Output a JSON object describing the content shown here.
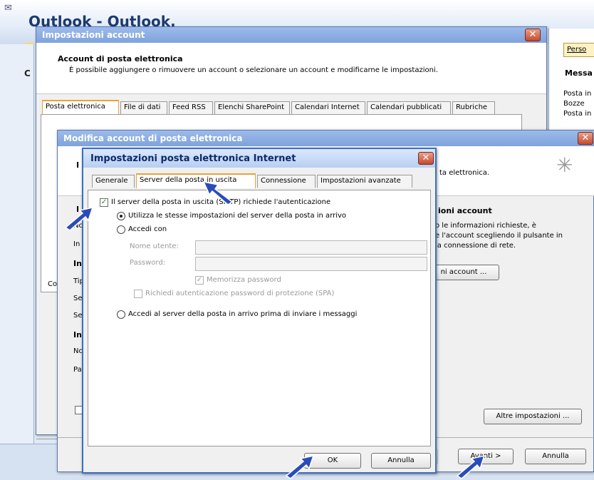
{
  "outlook": {
    "title": "Outlook - Outlook.",
    "left_letter": "C",
    "right_panel": {
      "button": "Perso",
      "header": "Messa",
      "items": [
        "Posta in",
        "Bozze",
        "Posta in"
      ]
    }
  },
  "account_window": {
    "title": "Impostazioni account",
    "heading": "Account di posta elettronica",
    "subtitle": "È possibile aggiungere o rimuovere un account o selezionare un account e modificarne le impostazioni.",
    "tabs": [
      "Posta elettronica",
      "File di dati",
      "Feed RSS",
      "Elenchi SharePoint",
      "Calendari Internet",
      "Calendari pubblicati",
      "Rubriche"
    ],
    "active_tab": "Posta elettronica"
  },
  "modify_window": {
    "title": "Modifica account di posta elettronica",
    "email_text": "ta elettronica.",
    "section_heading": "ioni account",
    "info_lines": [
      "o le informazioni richieste, è",
      "e l'account scegliendo il pulsante in",
      "la connessione di rete."
    ],
    "test_button": "ni account ...",
    "more_settings_button": "Altre impostazioni ...",
    "back_fragment": "<",
    "next_button": "Avanti >",
    "cancel_button": "Annulla",
    "left_letters": [
      "I",
      "I",
      "Nc",
      "In",
      "In",
      "Tip",
      "Se",
      "Se",
      "In",
      "Nc",
      "Pa",
      "Co"
    ]
  },
  "internet_dialog": {
    "title": "Impostazioni posta elettronica Internet",
    "tabs": [
      "Generale",
      "Server della posta in uscita",
      "Connessione",
      "Impostazioni avanzate"
    ],
    "active_tab": "Server della posta in uscita",
    "smtp_auth_label": "Il server della posta in uscita (SMTP) richiede l'autenticazione",
    "smtp_auth_checked": true,
    "use_same_label": "Utilizza le stesse impostazioni del server della posta in arrivo",
    "login_with_label": "Accedi con",
    "username_label": "Nome utente:",
    "password_label": "Password:",
    "remember_password_label": "Memorizza password",
    "spa_label": "Richiedi autenticazione password di protezione (SPA)",
    "login_incoming_first_label": "Accedi al server della posta in arrivo prima di inviare i messaggi",
    "ok_button": "OK",
    "cancel_button": "Annulla"
  },
  "colors": {
    "titlebar_blue": "#7ea2dc",
    "active_tab_accent": "#e8a43c",
    "close_red": "#c44a2e",
    "arrow_blue": "#2a4cb8"
  }
}
